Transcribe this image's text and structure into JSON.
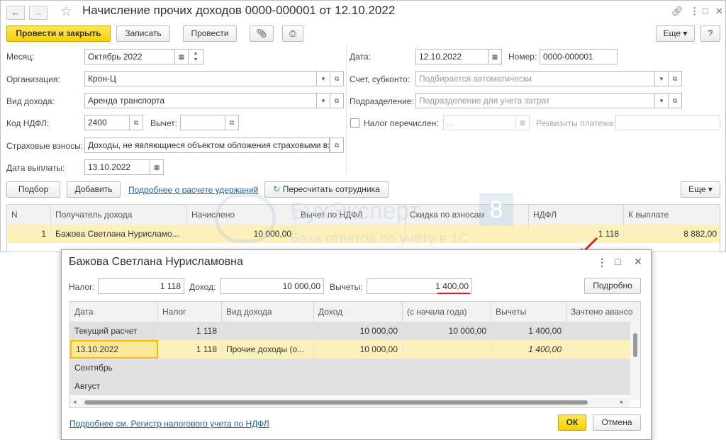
{
  "window": {
    "title": "Начисление прочих доходов 0000-000001 от 12.10.2022",
    "toolbar": {
      "post_close": "Провести и закрыть",
      "save": "Записать",
      "post": "Провести",
      "more": "Еще",
      "help": "?"
    },
    "form": {
      "month_label": "Месяц:",
      "month_value": "Октябрь 2022",
      "org_label": "Организация:",
      "org_value": "Крон-Ц",
      "income_type_label": "Вид дохода:",
      "income_type_value": "Аренда транспорта",
      "ndfl_code_label": "Код НДФЛ:",
      "ndfl_code_value": "2400",
      "deduction_label": "Вычет:",
      "insurance_label": "Страховые взносы:",
      "insurance_value": "Доходы, не являющиеся объектом обложения страховыми взносами",
      "payment_date_label": "Дата выплаты:",
      "payment_date_value": "13.10.2022",
      "date_label": "Дата:",
      "date_value": "12.10.2022",
      "number_label": "Номер:",
      "number_value": "0000-000001",
      "account_label": "Счет, субконто:",
      "account_placeholder": "Подбирается автоматически",
      "division_label": "Подразделение:",
      "division_placeholder": "Подразделение для учета затрат",
      "tax_paid_label": "Налог перечислен:",
      "tax_paid_value": ". .",
      "payment_details_label": "Реквизиты платежа:"
    },
    "table_toolbar": {
      "select": "Подбор",
      "add": "Добавить",
      "details_link": "Подробнее о расчете удержаний",
      "recalc": "Пересчитать сотрудника",
      "more": "Еще"
    },
    "table": {
      "headers": [
        "N",
        "Получатель дохода",
        "Начислено",
        "Вычет по НДФЛ",
        "Скидка по взносам",
        "НДФЛ",
        "К выплате"
      ],
      "rows": [
        [
          "1",
          "Бажова Светлана Нурисламо...",
          "10 000,00",
          "",
          "",
          "1 118",
          "8 882,00"
        ]
      ]
    },
    "watermark": {
      "brand": "БухЭксперт",
      "brand_num": "8",
      "tagline": "База ответов по учёту в 1С"
    }
  },
  "dialog": {
    "title": "Бажова Светлана Нурисламовна",
    "tax_label": "Налог:",
    "tax_value": "1 118",
    "income_label": "Доход:",
    "income_value": "10 000,00",
    "deductions_label": "Вычеты:",
    "deductions_value": "1 400,00",
    "details_button": "Подробно",
    "table": {
      "headers": [
        "Дата",
        "Налог",
        "Вид дохода",
        "Доход",
        "(с начала года)",
        "Вычеты",
        "Зачтено авансо"
      ],
      "rows": [
        [
          "Текущий расчет",
          "1 118",
          "",
          "10 000,00",
          "10 000,00",
          "1 400,00",
          ""
        ],
        [
          "13.10.2022",
          "1 118",
          "Прочие доходы (о...",
          "10 000,00",
          "",
          "1 400,00",
          ""
        ],
        [
          "Сентябрь",
          "",
          "",
          "",
          "",
          "",
          ""
        ],
        [
          "Август",
          "",
          "",
          "",
          "",
          "",
          ""
        ]
      ]
    },
    "register_link": "Подробнее см. Регистр налогового учета по НДФЛ",
    "ok": "ОК",
    "cancel": "Отмена"
  },
  "colors": {
    "accent_yellow": "#f5d000",
    "selected_row": "#fdf0bb",
    "annotation_red": "#e02020",
    "link_blue": "#1a5ea8"
  },
  "icons": [
    "back-arrow-icon",
    "forward-arrow-icon",
    "star-icon",
    "link-icon",
    "more-icon",
    "maximize-icon",
    "close-icon",
    "paperclip-icon",
    "print-icon",
    "calendar-icon",
    "open-icon",
    "refresh-icon"
  ]
}
